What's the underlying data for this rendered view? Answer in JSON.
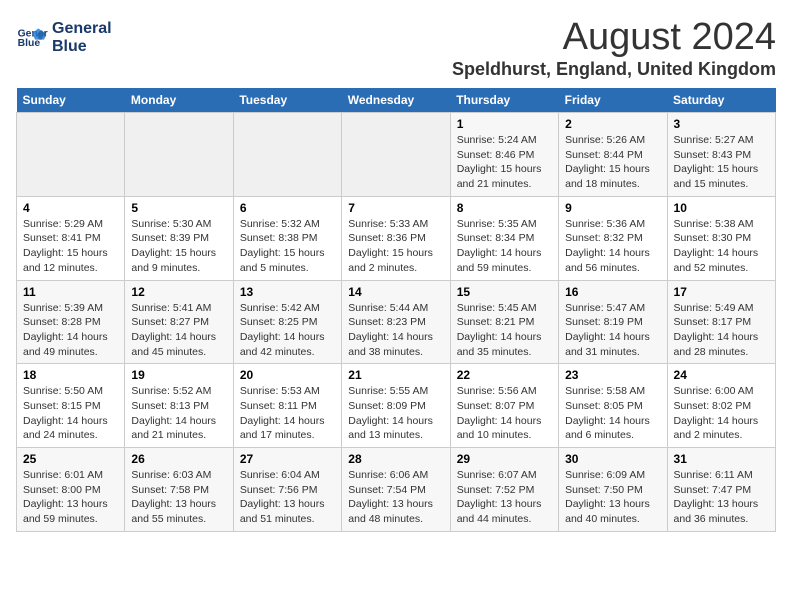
{
  "header": {
    "logo_line1": "General",
    "logo_line2": "Blue",
    "title": "August 2024",
    "subtitle": "Speldhurst, England, United Kingdom"
  },
  "calendar": {
    "weekdays": [
      "Sunday",
      "Monday",
      "Tuesday",
      "Wednesday",
      "Thursday",
      "Friday",
      "Saturday"
    ],
    "weeks": [
      [
        {
          "day": "",
          "info": ""
        },
        {
          "day": "",
          "info": ""
        },
        {
          "day": "",
          "info": ""
        },
        {
          "day": "",
          "info": ""
        },
        {
          "day": "1",
          "info": "Sunrise: 5:24 AM\nSunset: 8:46 PM\nDaylight: 15 hours\nand 21 minutes."
        },
        {
          "day": "2",
          "info": "Sunrise: 5:26 AM\nSunset: 8:44 PM\nDaylight: 15 hours\nand 18 minutes."
        },
        {
          "day": "3",
          "info": "Sunrise: 5:27 AM\nSunset: 8:43 PM\nDaylight: 15 hours\nand 15 minutes."
        }
      ],
      [
        {
          "day": "4",
          "info": "Sunrise: 5:29 AM\nSunset: 8:41 PM\nDaylight: 15 hours\nand 12 minutes."
        },
        {
          "day": "5",
          "info": "Sunrise: 5:30 AM\nSunset: 8:39 PM\nDaylight: 15 hours\nand 9 minutes."
        },
        {
          "day": "6",
          "info": "Sunrise: 5:32 AM\nSunset: 8:38 PM\nDaylight: 15 hours\nand 5 minutes."
        },
        {
          "day": "7",
          "info": "Sunrise: 5:33 AM\nSunset: 8:36 PM\nDaylight: 15 hours\nand 2 minutes."
        },
        {
          "day": "8",
          "info": "Sunrise: 5:35 AM\nSunset: 8:34 PM\nDaylight: 14 hours\nand 59 minutes."
        },
        {
          "day": "9",
          "info": "Sunrise: 5:36 AM\nSunset: 8:32 PM\nDaylight: 14 hours\nand 56 minutes."
        },
        {
          "day": "10",
          "info": "Sunrise: 5:38 AM\nSunset: 8:30 PM\nDaylight: 14 hours\nand 52 minutes."
        }
      ],
      [
        {
          "day": "11",
          "info": "Sunrise: 5:39 AM\nSunset: 8:28 PM\nDaylight: 14 hours\nand 49 minutes."
        },
        {
          "day": "12",
          "info": "Sunrise: 5:41 AM\nSunset: 8:27 PM\nDaylight: 14 hours\nand 45 minutes."
        },
        {
          "day": "13",
          "info": "Sunrise: 5:42 AM\nSunset: 8:25 PM\nDaylight: 14 hours\nand 42 minutes."
        },
        {
          "day": "14",
          "info": "Sunrise: 5:44 AM\nSunset: 8:23 PM\nDaylight: 14 hours\nand 38 minutes."
        },
        {
          "day": "15",
          "info": "Sunrise: 5:45 AM\nSunset: 8:21 PM\nDaylight: 14 hours\nand 35 minutes."
        },
        {
          "day": "16",
          "info": "Sunrise: 5:47 AM\nSunset: 8:19 PM\nDaylight: 14 hours\nand 31 minutes."
        },
        {
          "day": "17",
          "info": "Sunrise: 5:49 AM\nSunset: 8:17 PM\nDaylight: 14 hours\nand 28 minutes."
        }
      ],
      [
        {
          "day": "18",
          "info": "Sunrise: 5:50 AM\nSunset: 8:15 PM\nDaylight: 14 hours\nand 24 minutes."
        },
        {
          "day": "19",
          "info": "Sunrise: 5:52 AM\nSunset: 8:13 PM\nDaylight: 14 hours\nand 21 minutes."
        },
        {
          "day": "20",
          "info": "Sunrise: 5:53 AM\nSunset: 8:11 PM\nDaylight: 14 hours\nand 17 minutes."
        },
        {
          "day": "21",
          "info": "Sunrise: 5:55 AM\nSunset: 8:09 PM\nDaylight: 14 hours\nand 13 minutes."
        },
        {
          "day": "22",
          "info": "Sunrise: 5:56 AM\nSunset: 8:07 PM\nDaylight: 14 hours\nand 10 minutes."
        },
        {
          "day": "23",
          "info": "Sunrise: 5:58 AM\nSunset: 8:05 PM\nDaylight: 14 hours\nand 6 minutes."
        },
        {
          "day": "24",
          "info": "Sunrise: 6:00 AM\nSunset: 8:02 PM\nDaylight: 14 hours\nand 2 minutes."
        }
      ],
      [
        {
          "day": "25",
          "info": "Sunrise: 6:01 AM\nSunset: 8:00 PM\nDaylight: 13 hours\nand 59 minutes."
        },
        {
          "day": "26",
          "info": "Sunrise: 6:03 AM\nSunset: 7:58 PM\nDaylight: 13 hours\nand 55 minutes."
        },
        {
          "day": "27",
          "info": "Sunrise: 6:04 AM\nSunset: 7:56 PM\nDaylight: 13 hours\nand 51 minutes."
        },
        {
          "day": "28",
          "info": "Sunrise: 6:06 AM\nSunset: 7:54 PM\nDaylight: 13 hours\nand 48 minutes."
        },
        {
          "day": "29",
          "info": "Sunrise: 6:07 AM\nSunset: 7:52 PM\nDaylight: 13 hours\nand 44 minutes."
        },
        {
          "day": "30",
          "info": "Sunrise: 6:09 AM\nSunset: 7:50 PM\nDaylight: 13 hours\nand 40 minutes."
        },
        {
          "day": "31",
          "info": "Sunrise: 6:11 AM\nSunset: 7:47 PM\nDaylight: 13 hours\nand 36 minutes."
        }
      ]
    ]
  }
}
